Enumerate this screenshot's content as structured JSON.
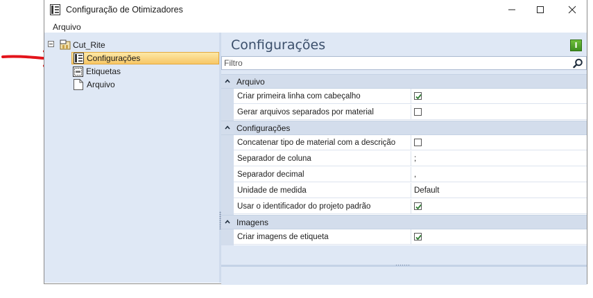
{
  "window": {
    "title": "Configuração de Otimizadores",
    "controls": {
      "minimize": "minimize-icon",
      "maximize": "maximize-icon",
      "close": "close-icon"
    }
  },
  "menu": {
    "items": [
      "Arquivo"
    ]
  },
  "tree": {
    "root": {
      "label": "Cut_Rite",
      "expanded": true,
      "icon": "cutrite-app-icon"
    },
    "children": [
      {
        "label": "Configurações",
        "selected": true,
        "icon": "settings-doc-icon"
      },
      {
        "label": "Etiquetas",
        "selected": false,
        "icon": "label-icon"
      },
      {
        "label": "Arquivo",
        "selected": false,
        "icon": "file-icon"
      }
    ]
  },
  "properties": {
    "title": "Configurações",
    "info_button": "I",
    "filter_placeholder": "Filtro",
    "groups": [
      {
        "label": "Arquivo",
        "rows": [
          {
            "name": "Criar primeira linha com cabeçalho",
            "type": "checkbox",
            "checked": true
          },
          {
            "name": "Gerar arquivos separados por material",
            "type": "checkbox",
            "checked": false
          }
        ]
      },
      {
        "label": "Configurações",
        "rows": [
          {
            "name": "Concatenar tipo de material com a descrição",
            "type": "checkbox",
            "checked": false
          },
          {
            "name": "Separador de coluna",
            "type": "text",
            "value": ";"
          },
          {
            "name": "Separador decimal",
            "type": "text",
            "value": ","
          },
          {
            "name": "Unidade de medida",
            "type": "text",
            "value": "Default"
          },
          {
            "name": "Usar o identificador do projeto padrão",
            "type": "checkbox",
            "checked": true
          }
        ]
      },
      {
        "label": "Imagens",
        "rows": [
          {
            "name": "Criar imagens de etiqueta",
            "type": "checkbox",
            "checked": true
          }
        ]
      }
    ]
  },
  "colors": {
    "selection": "#f7c766",
    "pane_background": "#dfe8f5",
    "arrow": "#e3141b",
    "checkmark": "#2e7d32"
  }
}
